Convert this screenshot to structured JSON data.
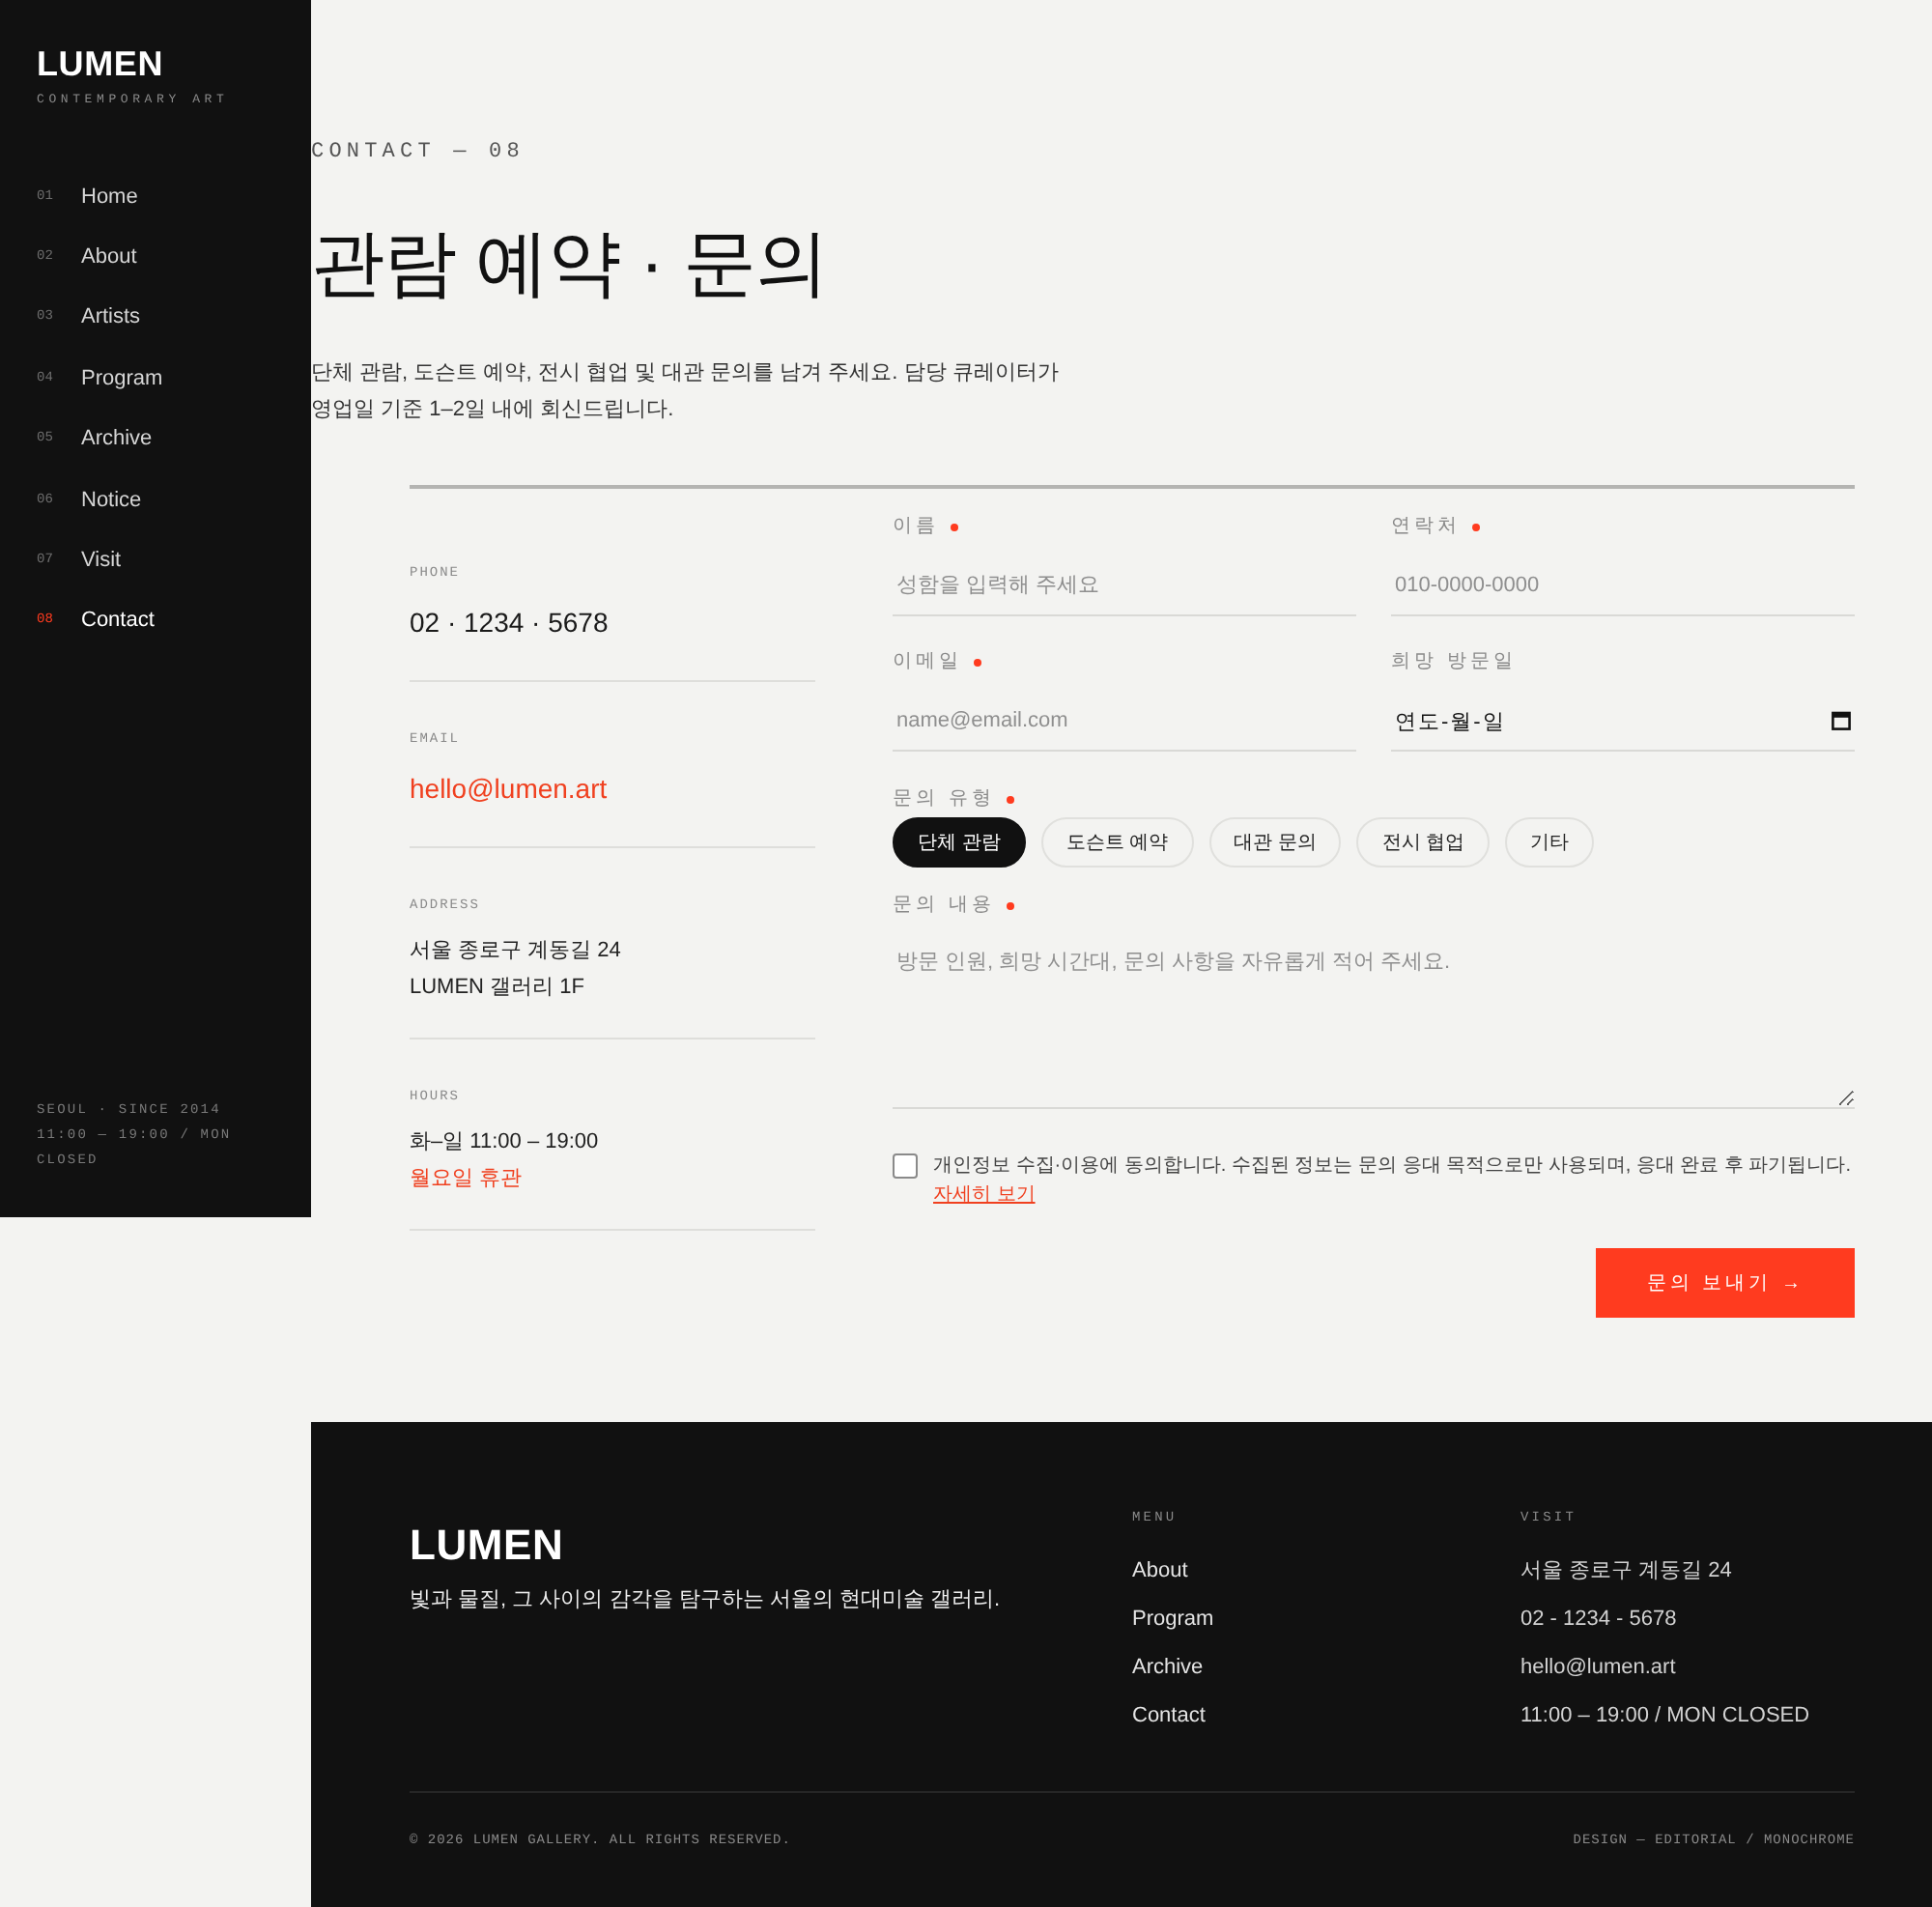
{
  "sidebar": {
    "logo": "LUMEN",
    "tagline": "CONTEMPORARY ART",
    "nav": [
      {
        "number": "01",
        "label": "Home",
        "selected": false
      },
      {
        "number": "02",
        "label": "About",
        "selected": false
      },
      {
        "number": "03",
        "label": "Artists",
        "selected": false
      },
      {
        "number": "04",
        "label": "Program",
        "selected": false
      },
      {
        "number": "05",
        "label": "Archive",
        "selected": false
      },
      {
        "number": "06",
        "label": "Notice",
        "selected": false
      },
      {
        "number": "07",
        "label": "Visit",
        "selected": false
      },
      {
        "number": "08",
        "label": "Contact",
        "selected": true
      }
    ],
    "info": [
      "SEOUL · SINCE 2014",
      "11:00 — 19:00 / MON CLOSED"
    ]
  },
  "header": {
    "eyebrow": "CONTACT — 08",
    "title": "관람 예약 · 문의",
    "intro": "단체 관람, 도슨트 예약, 전시 협업 및 대관 문의를 남겨 주세요. 담당 큐레이터가 영업일 기준 1–2일 내에 회신드립니다."
  },
  "contact_info": [
    {
      "label": "PHONE",
      "kind": "phone",
      "lines": [
        {
          "text": "02 · 1234 · 5678",
          "highlight": false
        }
      ]
    },
    {
      "label": "EMAIL",
      "kind": "email",
      "lines": [
        {
          "text": "hello@lumen.art",
          "highlight": true
        }
      ]
    },
    {
      "label": "ADDRESS",
      "kind": "address",
      "lines": [
        {
          "text": "서울 종로구 계동길 24",
          "highlight": false
        },
        {
          "text": "LUMEN 갤러리 1F",
          "highlight": false
        }
      ]
    },
    {
      "label": "HOURS",
      "kind": "hours",
      "lines": [
        {
          "text": "화–일 11:00 – 19:00",
          "highlight": false
        },
        {
          "text": "월요일 휴관",
          "highlight": true
        }
      ]
    }
  ],
  "form": {
    "fields": [
      {
        "label": "이름",
        "required": true,
        "kind": "text",
        "placeholder": "성함을 입력해 주세요"
      },
      {
        "label": "연락처",
        "required": true,
        "kind": "text",
        "placeholder": "010-0000-0000"
      },
      {
        "label": "이메일",
        "required": true,
        "kind": "text",
        "placeholder": "name@email.com"
      },
      {
        "label": "희망 방문일",
        "required": false,
        "kind": "date",
        "value": "연도-월-일"
      }
    ],
    "inquiry_type": {
      "label": "문의 유형",
      "required": true,
      "options": [
        {
          "label": "단체 관람",
          "selected": true
        },
        {
          "label": "도슨트 예약",
          "selected": false
        },
        {
          "label": "대관 문의",
          "selected": false
        },
        {
          "label": "전시 협업",
          "selected": false
        },
        {
          "label": "기타",
          "selected": false
        }
      ]
    },
    "message": {
      "label": "문의 내용",
      "required": true,
      "placeholder": "방문 인원, 희망 시간대, 문의 사항을 자유롭게 적어 주세요."
    },
    "consent": {
      "checked": false,
      "text": "개인정보 수집·이용에 동의합니다. 수집된 정보는 문의 응대 목적으로만 사용되며, 응대 완료 후 파기됩니다.",
      "link": "자세히 보기"
    },
    "submit": "문의 보내기 →"
  },
  "footer": {
    "logo": "LUMEN",
    "tagline": "빛과 물질, 그 사이의 감각을 탐구하는 서울의 현대미술 갤러리.",
    "columns": [
      {
        "heading": "MENU",
        "kind": "links",
        "items": [
          "About",
          "Program",
          "Archive",
          "Contact"
        ]
      },
      {
        "heading": "VISIT",
        "kind": "text",
        "items": [
          "서울 종로구 계동길 24",
          "02 - 1234 - 5678",
          "hello@lumen.art",
          "11:00 – 19:00 / MON CLOSED"
        ]
      }
    ],
    "copyright": "© 2026 LUMEN GALLERY. ALL RIGHTS RESERVED.",
    "credit": "DESIGN — EDITORIAL / MONOCHROME"
  }
}
